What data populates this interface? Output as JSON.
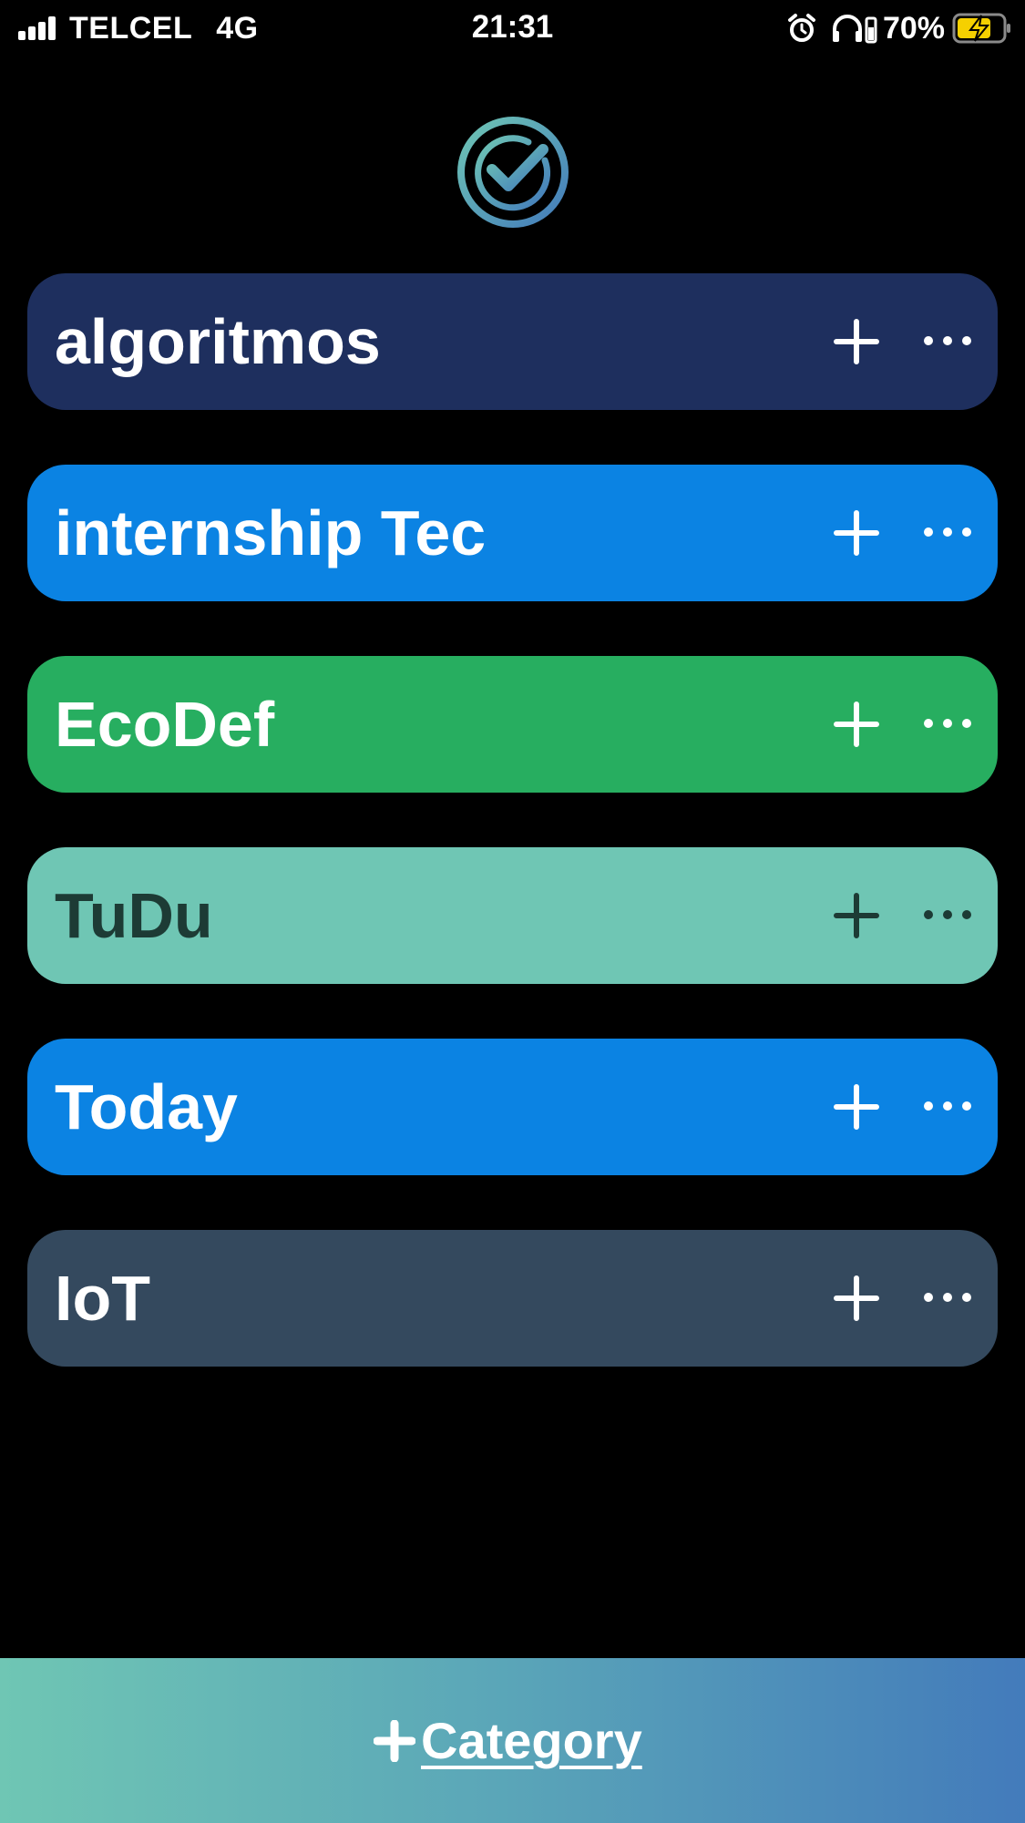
{
  "status_bar": {
    "carrier": "TELCEL",
    "network": "4G",
    "time": "21:31",
    "battery_percent": "70%",
    "icons": [
      "signal-icon",
      "alarm-icon",
      "headphones-battery-icon",
      "battery-charging-icon"
    ]
  },
  "app": {
    "logo_icon": "check-circle-logo-icon"
  },
  "categories": [
    {
      "name": "algoritmos",
      "bg": "#1e2f5e",
      "fg": "#ffffff"
    },
    {
      "name": "internship Tec",
      "bg": "#0b83e3",
      "fg": "#ffffff"
    },
    {
      "name": "EcoDef",
      "bg": "#27ae60",
      "fg": "#ffffff"
    },
    {
      "name": "TuDu",
      "bg": "#6fc6b4",
      "fg": "#1d3b35"
    },
    {
      "name": "Today",
      "bg": "#0b83e3",
      "fg": "#ffffff"
    },
    {
      "name": "IoT",
      "bg": "#34495e",
      "fg": "#ffffff"
    }
  ],
  "bottom_bar": {
    "add_category_label": "Category",
    "add_icon": "plus-icon",
    "gradient": [
      "#6fc6b4",
      "#437bbb"
    ]
  }
}
